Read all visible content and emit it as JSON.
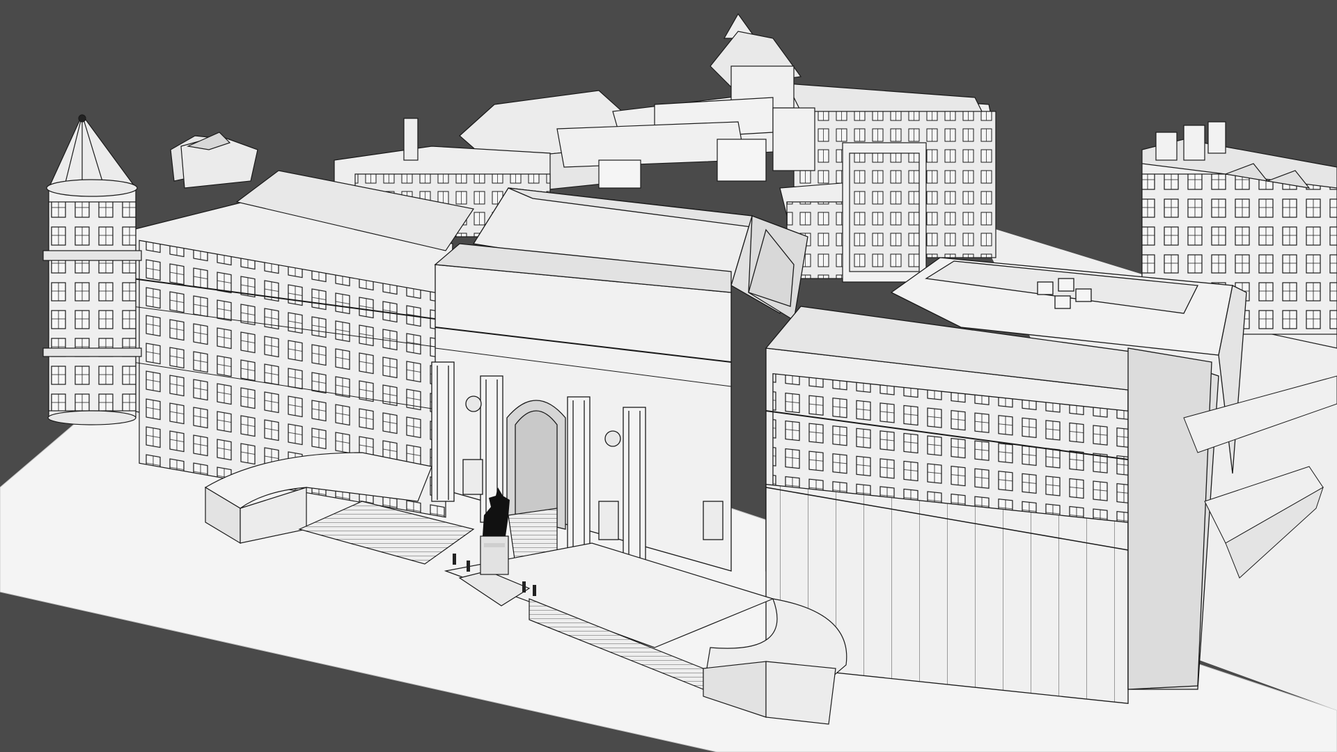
{
  "scene": {
    "description_kind": "3d-wireframe-render",
    "background_color": "#4a4a4a",
    "ground_color": "#f4f4f4",
    "building_fill": "#f2f2f2",
    "building_shade": "#e2e2e2",
    "building_dark": "#cfcfcf",
    "line_color": "#1a1a1a",
    "window_color": "#8c8c8c",
    "statue_color": "#111111"
  }
}
